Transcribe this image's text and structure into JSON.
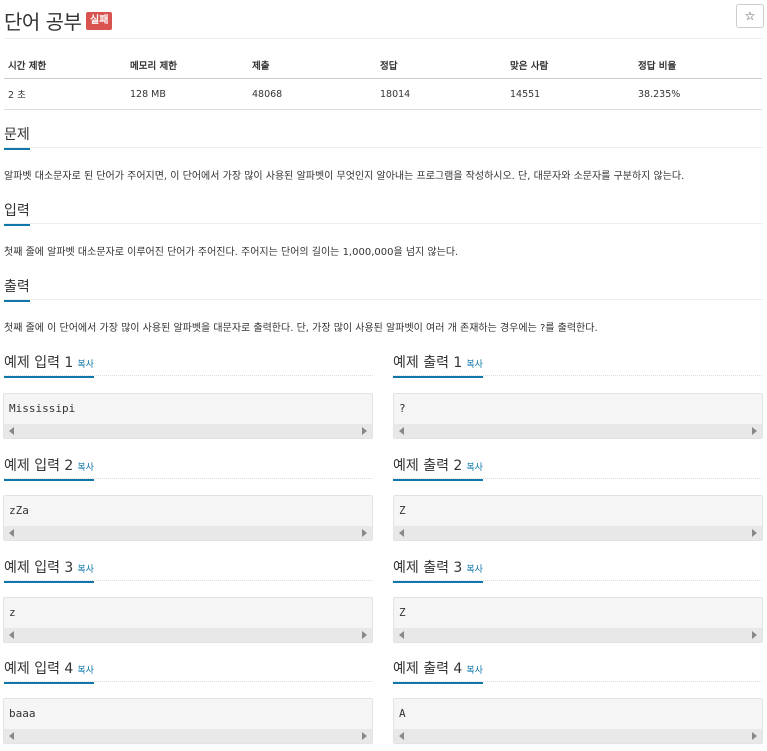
{
  "problem": {
    "title": "단어 공부",
    "badge": "실패",
    "star": "☆"
  },
  "info_table": {
    "headers": [
      "시간 제한",
      "메모리 제한",
      "제출",
      "정답",
      "맞은 사람",
      "정답 비율"
    ],
    "values": [
      "2 초",
      "128 MB",
      "48068",
      "18014",
      "14551",
      "38.235%"
    ]
  },
  "sections": {
    "problem_heading": "문제",
    "problem_text": "알파벳 대소문자로 된 단어가 주어지면, 이 단어에서 가장 많이 사용된 알파벳이 무엇인지 알아내는 프로그램을 작성하시오. 단, 대문자와 소문자를 구분하지 않는다.",
    "input_heading": "입력",
    "input_text": "첫째 줄에 알파벳 대소문자로 이루어진 단어가 주어진다. 주어지는 단어의 길이는 1,000,000을 넘지 않는다.",
    "output_heading": "출력",
    "output_text": "첫째 줄에 이 단어에서 가장 많이 사용된 알파벳을 대문자로 출력한다. 단, 가장 많이 사용된 알파벳이 여러 개 존재하는 경우에는 ?를 출력한다."
  },
  "copy_label": "복사",
  "examples": [
    {
      "input_title": "예제 입력 1",
      "output_title": "예제 출력 1",
      "input": "Mississipi",
      "output": "?"
    },
    {
      "input_title": "예제 입력 2",
      "output_title": "예제 출력 2",
      "input": "zZa",
      "output": "Z"
    },
    {
      "input_title": "예제 입력 3",
      "output_title": "예제 출력 3",
      "input": "z",
      "output": "Z"
    },
    {
      "input_title": "예제 입력 4",
      "output_title": "예제 출력 4",
      "input": "baaa",
      "output": "A"
    }
  ]
}
